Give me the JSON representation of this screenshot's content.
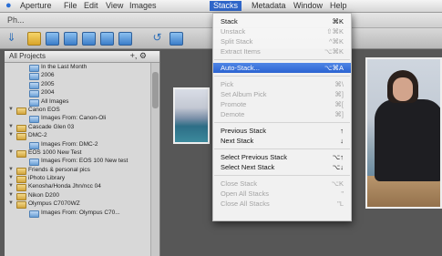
{
  "menubar": {
    "items": [
      "Aperture",
      "File",
      "Edit",
      "View",
      "Images",
      "Stacks",
      "Metadata",
      "Window",
      "Help"
    ],
    "active": "Stacks"
  },
  "window": {
    "title": "Ph..."
  },
  "sidebar": {
    "header": "All Projects",
    "controls": "+, ⚙",
    "items": [
      {
        "label": "In the Last Month",
        "kind": "stack",
        "level": 1
      },
      {
        "label": "2006",
        "kind": "stack",
        "level": 1
      },
      {
        "label": "2005",
        "kind": "stack",
        "level": 1
      },
      {
        "label": "2004",
        "kind": "stack",
        "level": 1
      },
      {
        "label": "All Images",
        "kind": "stack",
        "level": 1
      },
      {
        "label": "Canon EOS",
        "kind": "proj",
        "level": 0
      },
      {
        "label": "Images From: Canon-Oli",
        "kind": "stack",
        "level": 1
      },
      {
        "label": "Cascade Glen 03",
        "kind": "proj",
        "level": 0
      },
      {
        "label": "DMC-2",
        "kind": "proj",
        "level": 0
      },
      {
        "label": "Images From: DMC-2",
        "kind": "stack",
        "level": 1
      },
      {
        "label": "EOS 1000 New Test",
        "kind": "proj",
        "level": 0
      },
      {
        "label": "Images From: EOS 100 New test",
        "kind": "stack",
        "level": 1
      },
      {
        "label": "Friends & personal pics",
        "kind": "proj",
        "level": 0
      },
      {
        "label": "iPhoto Library",
        "kind": "proj",
        "level": 0
      },
      {
        "label": "Kenosha/Honda Jhn/ncc 04",
        "kind": "proj",
        "level": 0
      },
      {
        "label": "Nikon D200",
        "kind": "proj",
        "level": 0
      },
      {
        "label": "Olympus C7070WZ",
        "kind": "proj",
        "level": 0
      },
      {
        "label": "Images From: Olympus C70...",
        "kind": "stack",
        "level": 1
      }
    ]
  },
  "stacks_menu": {
    "items": [
      {
        "label": "Stack",
        "shortcut": "⌘K",
        "state": "enabled"
      },
      {
        "label": "Unstack",
        "shortcut": "⇧⌘K",
        "state": "disabled"
      },
      {
        "label": "Split Stack",
        "shortcut": "^⌘K",
        "state": "disabled"
      },
      {
        "label": "Extract Items",
        "shortcut": "⌥⌘K",
        "state": "disabled"
      },
      {
        "sep": true
      },
      {
        "label": "Auto-Stack...",
        "shortcut": "⌥⌘A",
        "state": "highlighted"
      },
      {
        "sep": true
      },
      {
        "label": "Pick",
        "shortcut": "⌘\\",
        "state": "disabled"
      },
      {
        "label": "Set Album Pick",
        "shortcut": "⌘]",
        "state": "disabled"
      },
      {
        "label": "Promote",
        "shortcut": "⌘[",
        "state": "disabled"
      },
      {
        "label": "Demote",
        "shortcut": "⌘]",
        "state": "disabled"
      },
      {
        "sep": true
      },
      {
        "label": "Previous Stack",
        "shortcut": "↑",
        "state": "enabled"
      },
      {
        "label": "Next Stack",
        "shortcut": "↓",
        "state": "enabled"
      },
      {
        "sep": true
      },
      {
        "label": "Select Previous Stack",
        "shortcut": "⌥↑",
        "state": "enabled"
      },
      {
        "label": "Select Next Stack",
        "shortcut": "⌥↓",
        "state": "enabled"
      },
      {
        "sep": true
      },
      {
        "label": "Close Stack",
        "shortcut": "⌥K",
        "state": "disabled"
      },
      {
        "label": "Open All Stacks",
        "shortcut": "\"",
        "state": "disabled"
      },
      {
        "label": "Close All Stacks",
        "shortcut": "\"L",
        "state": "disabled"
      }
    ]
  },
  "colors": {
    "menu_highlight": "#2b63d1",
    "menubar_active": "#2f66c9",
    "folder": "#d9a52b",
    "stack_icon": "#6a9fd6"
  }
}
